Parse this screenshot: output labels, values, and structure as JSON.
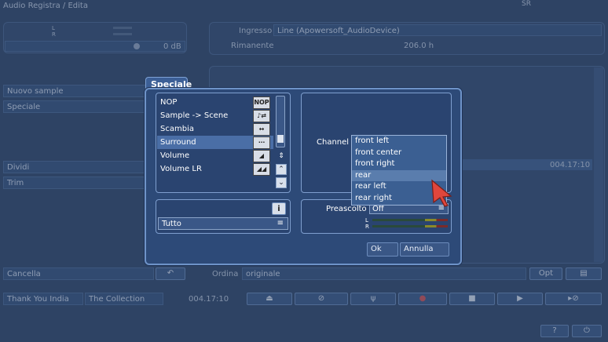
{
  "window": {
    "title": "Audio Registra / Edita",
    "top_right_label": "SR"
  },
  "left": {
    "level_L": "L",
    "level_R": "R",
    "db_value": "0 dB",
    "items": [
      "Nuovo sample",
      "Speciale",
      "Dividi",
      "Trim"
    ],
    "cancel_label": "Cancella"
  },
  "right": {
    "input_label": "Ingresso",
    "input_value": "Line (Apowersoft_AudioDevice)",
    "remaining_label": "Rimanente",
    "remaining_value": "206.0 h",
    "row_time": "004.17:10",
    "sort_label": "Ordina",
    "sort_value": "originale",
    "opt_label": "Opt"
  },
  "bottom": {
    "track_title": "Thank You India",
    "album": "The Collection",
    "time": "004.17:10"
  },
  "dialog": {
    "title": "Speciale",
    "list": [
      {
        "label": "NOP",
        "icon": "NOP"
      },
      {
        "label": "Sample -> Scene",
        "icon": "♪⇄"
      },
      {
        "label": "Scambia",
        "icon": "↔"
      },
      {
        "label": "Surround",
        "icon": "⋯"
      },
      {
        "label": "Volume",
        "icon": "◢"
      },
      {
        "label": "Volume LR",
        "icon": "◢◢"
      }
    ],
    "selected_index": 3,
    "info_icon": "i",
    "scope_value": "Tutto",
    "channel_label": "Channel",
    "channel_options": [
      "front left",
      "front center",
      "front right",
      "rear",
      "rear left",
      "rear right"
    ],
    "channel_selected": "rear",
    "preview_label": "Preascolto",
    "preview_value": "Off",
    "meter_L": "L",
    "meter_R": "R",
    "ok_label": "Ok",
    "cancel_label": "Annulla"
  },
  "colors": {
    "background": "#2e4364",
    "dialog_border": "#6e93c8",
    "selection": "#4a6ea6",
    "cursor": "#e0463c"
  }
}
